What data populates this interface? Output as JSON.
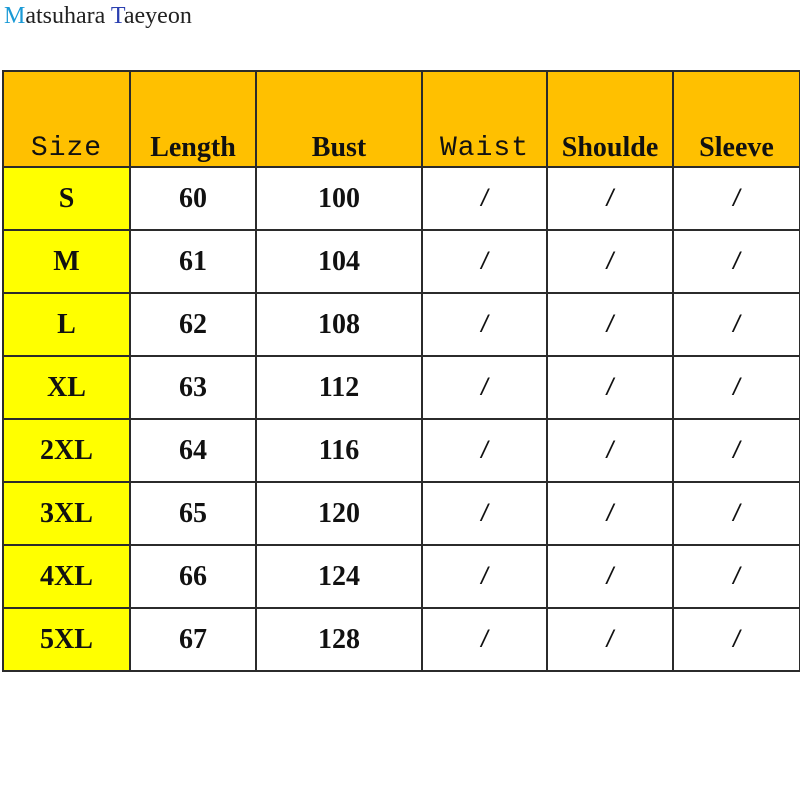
{
  "brand": {
    "initial1": "M",
    "rest1": "atsuhara ",
    "initial2": "T",
    "rest2": "aeyeon"
  },
  "colors": {
    "header_bg": "#ffc000",
    "size_col_bg": "#ffff00",
    "brand_initial_m": "#1a9ad6",
    "brand_initial_t": "#2a3fb0"
  },
  "table": {
    "headers": [
      "Size",
      "Length",
      "Bust",
      "Waist",
      "Shoulde",
      "Sleeve"
    ],
    "rows": [
      [
        "S",
        "60",
        "100",
        "/",
        "/",
        "/"
      ],
      [
        "M",
        "61",
        "104",
        "/",
        "/",
        "/"
      ],
      [
        "L",
        "62",
        "108",
        "/",
        "/",
        "/"
      ],
      [
        "XL",
        "63",
        "112",
        "/",
        "/",
        "/"
      ],
      [
        "2XL",
        "64",
        "116",
        "/",
        "/",
        "/"
      ],
      [
        "3XL",
        "65",
        "120",
        "/",
        "/",
        "/"
      ],
      [
        "4XL",
        "66",
        "124",
        "/",
        "/",
        "/"
      ],
      [
        "5XL",
        "67",
        "128",
        "/",
        "/",
        "/"
      ]
    ]
  }
}
